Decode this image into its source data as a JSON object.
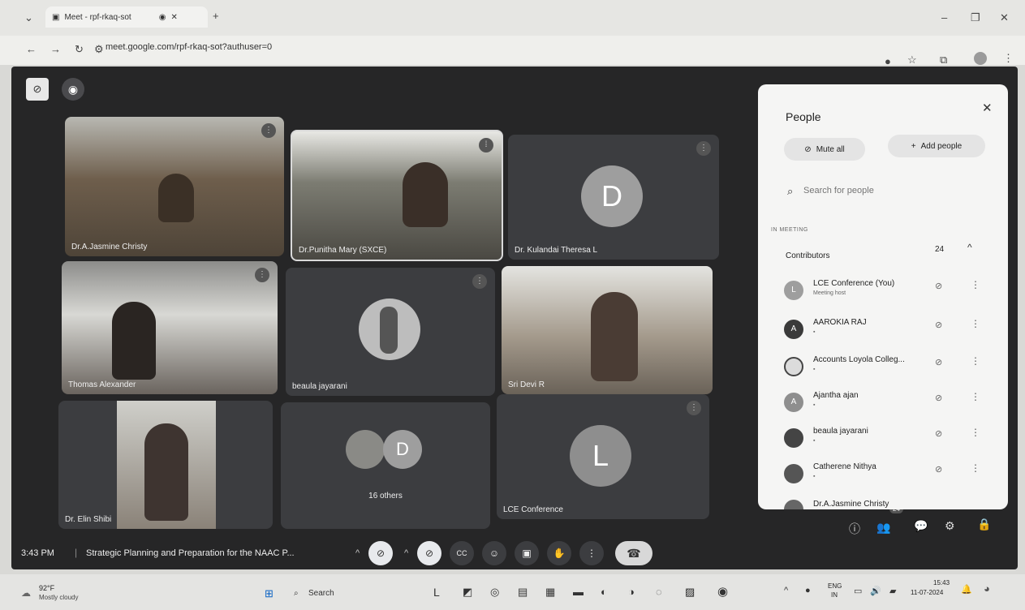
{
  "browser": {
    "tab_title": "Meet - rpf-rkaq-sot",
    "url": "meet.google.com/rpf-rkaq-sot?authuser=0"
  },
  "meeting": {
    "tiles": [
      {
        "name": "Dr.A.Jasmine Christy"
      },
      {
        "name": "Dr.Punitha Mary (SXCE)"
      },
      {
        "name": "Dr. Kulandai Theresa L",
        "initial": "D"
      },
      {
        "name": "Thomas Alexander"
      },
      {
        "name": "beaula jayarani"
      },
      {
        "name": "Sri Devi R"
      },
      {
        "name": "Dr. Elin Shibi"
      },
      {
        "name": "16 others",
        "initial": "D"
      },
      {
        "name": "LCE Conference",
        "initial": "L"
      }
    ],
    "time": "3:43 PM",
    "title": "Strategic Planning and Preparation for the NAAC P...",
    "people_badge": "24"
  },
  "people_panel": {
    "title": "People",
    "mute_all": "Mute all",
    "add_people": "Add people",
    "search_placeholder": "Search for people",
    "section": "IN MEETING",
    "group": "Contributors",
    "count": "24",
    "participants": [
      {
        "name": "LCE Conference (You)",
        "sub": "Meeting host",
        "initial": "L",
        "color": "#9e9e9e"
      },
      {
        "name": "AAROKIA RAJ",
        "sub": "",
        "initial": "A",
        "color": "#3a3a3a"
      },
      {
        "name": "Accounts Loyola Colleg...",
        "sub": "",
        "initial": "",
        "color": "#dcdcdc"
      },
      {
        "name": "Ajantha ajan",
        "sub": "",
        "initial": "A",
        "color": "#8e8e8e"
      },
      {
        "name": "beaula jayarani",
        "sub": "",
        "initial": "",
        "color": "#444444"
      },
      {
        "name": "Catherene Nithya",
        "sub": "",
        "initial": "",
        "color": "#555555"
      },
      {
        "name": "Dr.A.Jasmine Christy",
        "sub": "",
        "initial": "",
        "color": "#666666"
      }
    ]
  },
  "taskbar": {
    "weather_temp": "92°F",
    "weather_desc": "Mostly cloudy",
    "search": "Search",
    "lang1": "ENG",
    "lang2": "IN",
    "clock_time": "15:43",
    "clock_date": "11-07-2024"
  }
}
